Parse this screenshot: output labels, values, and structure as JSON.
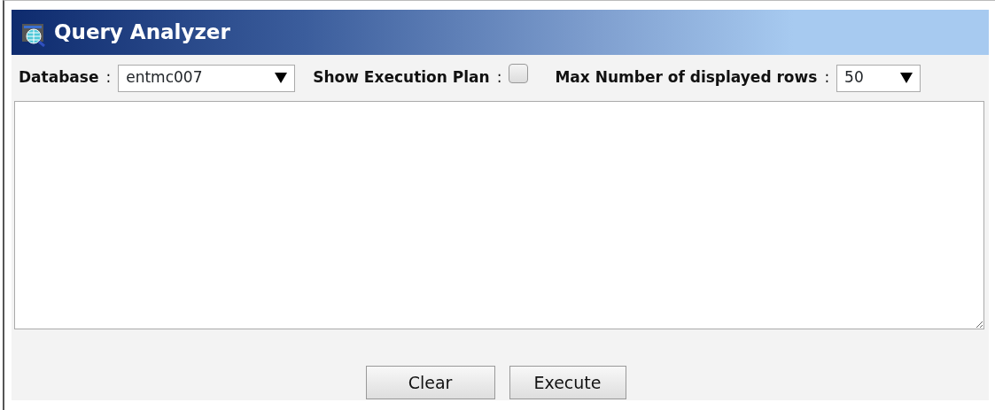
{
  "header": {
    "title": "Query Analyzer"
  },
  "database": {
    "label": "Database",
    "separator": ":",
    "value": "entmc007"
  },
  "execution_plan": {
    "label": "Show Execution Plan",
    "separator": ":",
    "checked": false
  },
  "max_rows": {
    "label": "Max Number of displayed rows",
    "separator": ":",
    "value": "50"
  },
  "buttons": [
    {
      "label": "Clear"
    },
    {
      "label": "Execute"
    }
  ]
}
